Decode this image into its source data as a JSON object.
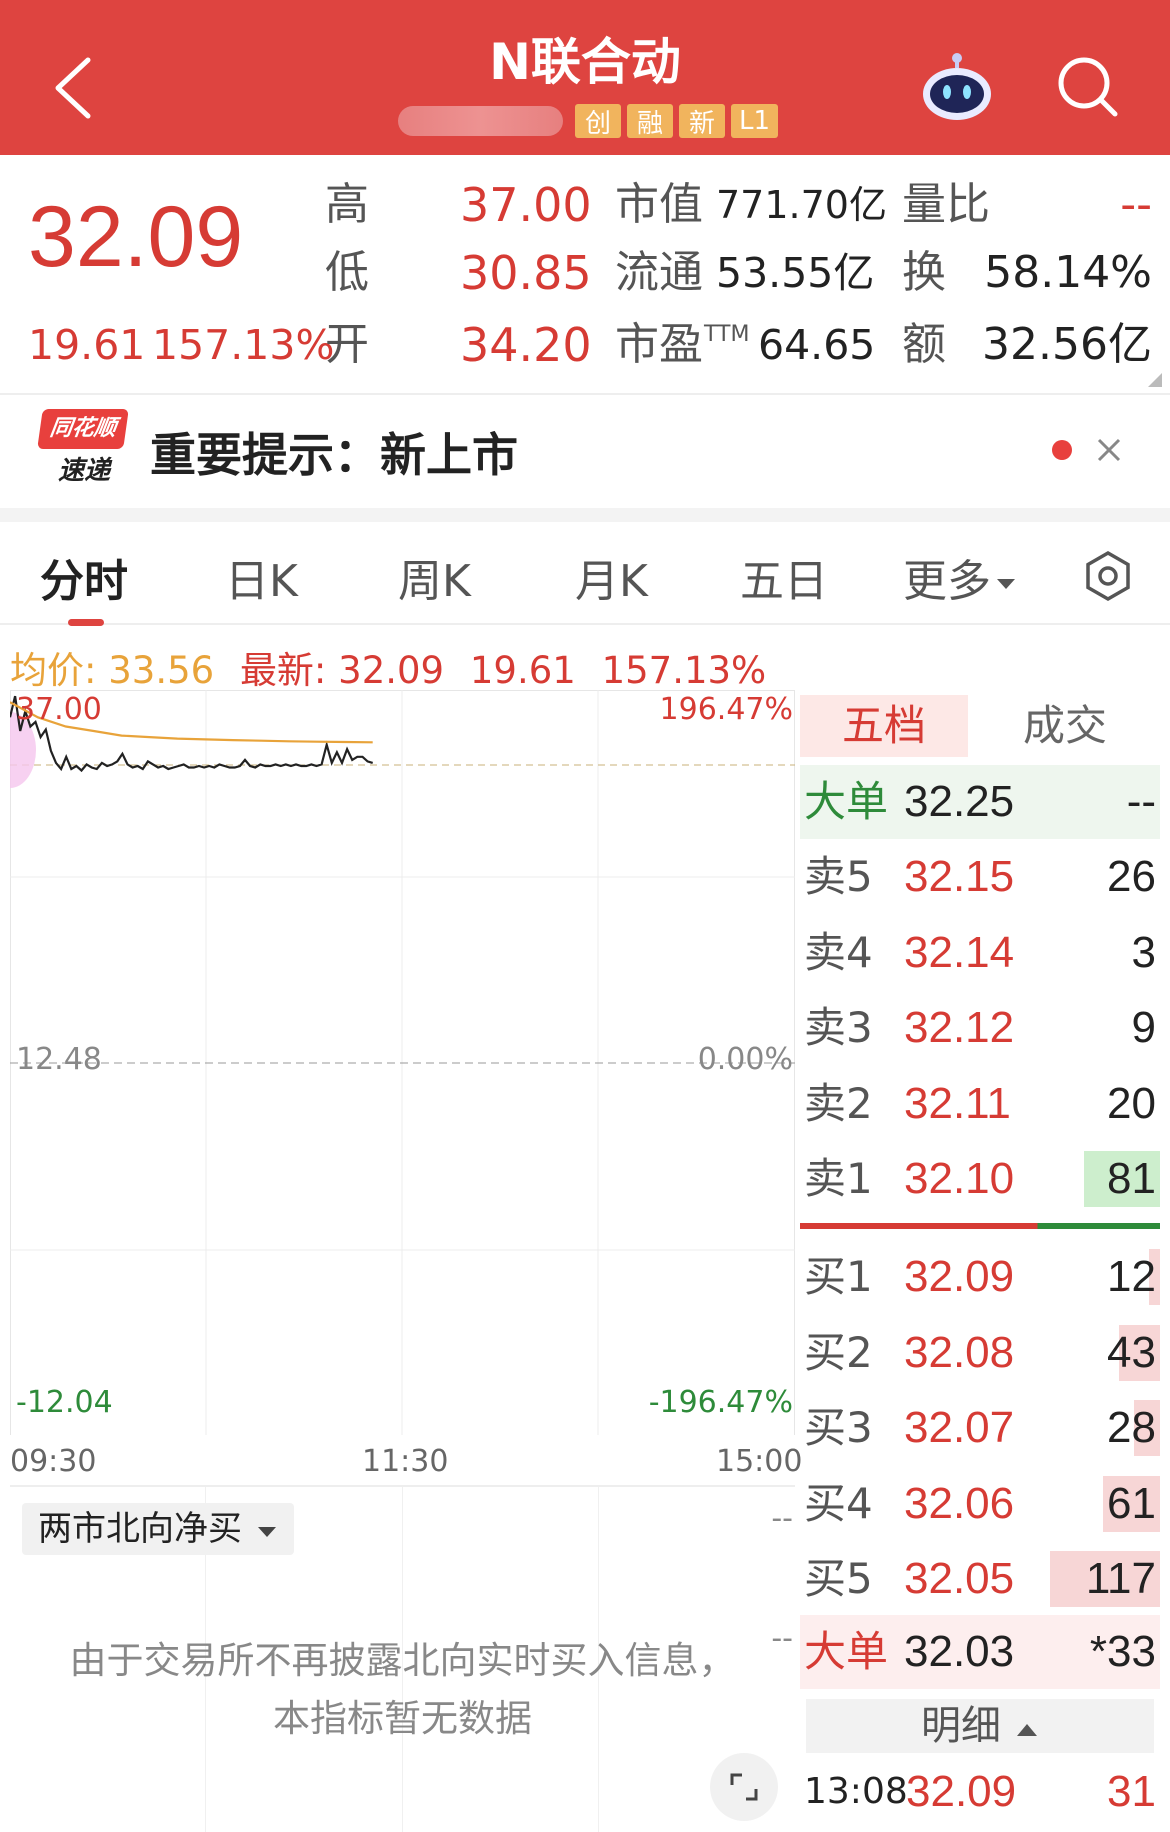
{
  "header": {
    "title": "N联合动",
    "tags": [
      "创",
      "融",
      "新",
      "L1"
    ]
  },
  "quote": {
    "price": "32.09",
    "change": "19.61",
    "change_pct": "157.13%",
    "high_label": "高",
    "high": "37.00",
    "low_label": "低",
    "low": "30.85",
    "open_label": "开",
    "open": "34.20",
    "mcap_label": "市值",
    "mcap": "771.70亿",
    "float_label": "流通",
    "float": "53.55亿",
    "pe_label": "市盈",
    "pe_sup": "TTM",
    "pe": "64.65",
    "vr_label": "量比",
    "vr": "--",
    "turn_label": "换",
    "turn": "58.14%",
    "amount_label": "额",
    "amount": "32.56亿"
  },
  "tip": {
    "logo_top": "同花顺",
    "logo_bottom": "速递",
    "text": "重要提示：新上市"
  },
  "tabs": [
    "分时",
    "日K",
    "周K",
    "月K",
    "五日",
    "更多"
  ],
  "avg": {
    "avg_label": "均价:",
    "avg_value": "33.56",
    "latest_label": "最新:",
    "latest_value": "32.09",
    "change": "19.61",
    "change_pct": "157.13%"
  },
  "chart_labels": {
    "top_left": "37.00",
    "top_right": "196.47%",
    "mid_left": "12.48",
    "mid_right": "0.00%",
    "bottom_left": "-12.04",
    "bottom_right": "-196.47%",
    "t0": "09:30",
    "t1": "11:30",
    "t2": "15:00"
  },
  "chart_data": {
    "type": "line",
    "x_range": [
      "09:30",
      "15:00"
    ],
    "ylim": [
      -12.04,
      37.0
    ],
    "series": [
      {
        "color": "#222222",
        "values": [
          35.2,
          36.6,
          34.3,
          35.6,
          34.6,
          34.9,
          33.9,
          34.4,
          33.0,
          32.2,
          31.8,
          32.6,
          31.8,
          32.0,
          31.7,
          32.1,
          31.9,
          31.8,
          32.2,
          32.0,
          32.1,
          32.3,
          32.8,
          32.1,
          31.9,
          32.0,
          31.8,
          32.3,
          32.1,
          31.9,
          32.0,
          31.8,
          31.9,
          32.0,
          32.1,
          31.9,
          31.9,
          32.0,
          31.9,
          32.0,
          31.9,
          32.1,
          32.0,
          31.9,
          31.9,
          32.0,
          32.4,
          32.0,
          31.9,
          32.1,
          32.0,
          32.0,
          32.1,
          32.0,
          32.1,
          32.0,
          32.1,
          32.0,
          32.0,
          32.1,
          32.0,
          32.1,
          33.4,
          32.2,
          32.9,
          32.2,
          33.1,
          32.4,
          32.6,
          32.6,
          32.3,
          32.2
        ]
      },
      {
        "color": "#e8a33a",
        "values": [
          36.2,
          35.2,
          34.6,
          34.3,
          34.0,
          33.9,
          33.8,
          33.75,
          33.7,
          33.66,
          33.62,
          33.6,
          33.58,
          33.56
        ]
      }
    ]
  },
  "bottom": {
    "select": "两市北向净买",
    "notice_line1": "由于交易所不再披露北向实时买入信息，",
    "notice_line2": "本指标暂无数据",
    "dashes": "--"
  },
  "book": {
    "tab_active": "五档",
    "tab_other": "成交",
    "big_top": {
      "label": "大单",
      "price": "32.25",
      "vol": "--"
    },
    "asks": [
      {
        "label": "卖5",
        "price": "32.15",
        "vol": "26",
        "fill": 0.0
      },
      {
        "label": "卖4",
        "price": "32.14",
        "vol": "3",
        "fill": 0.0
      },
      {
        "label": "卖3",
        "price": "32.12",
        "vol": "9",
        "fill": 0.0
      },
      {
        "label": "卖2",
        "price": "32.11",
        "vol": "20",
        "fill": 0.0
      },
      {
        "label": "卖1",
        "price": "32.10",
        "vol": "81",
        "fill": 0.69
      }
    ],
    "bids": [
      {
        "label": "买1",
        "price": "32.09",
        "vol": "12",
        "fill": 0.1
      },
      {
        "label": "买2",
        "price": "32.08",
        "vol": "43",
        "fill": 0.37
      },
      {
        "label": "买3",
        "price": "32.07",
        "vol": "28",
        "fill": 0.24
      },
      {
        "label": "买4",
        "price": "32.06",
        "vol": "61",
        "fill": 0.52
      },
      {
        "label": "买5",
        "price": "32.05",
        "vol": "117",
        "fill": 1.0
      }
    ],
    "big_bottom": {
      "label": "大单",
      "price": "32.03",
      "vol": "*33"
    },
    "detail_label": "明细",
    "trade": {
      "time": "13:08",
      "price": "32.09",
      "vol": "31"
    }
  },
  "colors": {
    "header": "#de4440",
    "up": "#d63b34",
    "down": "#2e8b3a",
    "avg_line": "#e8a33a",
    "tag": "#f1b45d"
  }
}
